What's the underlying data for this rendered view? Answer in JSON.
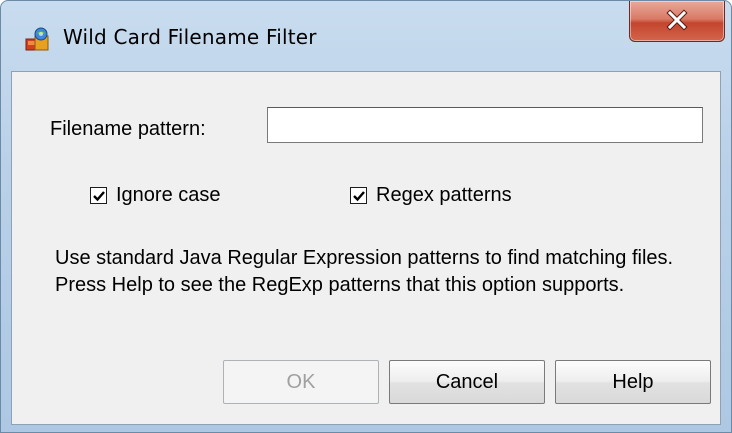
{
  "window": {
    "title": "Wild Card Filename Filter",
    "icon": "app-icon",
    "close_icon": "close-icon"
  },
  "form": {
    "pattern_label": "Filename pattern:",
    "pattern_value": "",
    "pattern_placeholder": ""
  },
  "options": {
    "ignore_case": {
      "label": "Ignore case",
      "checked": true
    },
    "regex_patterns": {
      "label": "Regex patterns",
      "checked": true
    }
  },
  "help_text": "Use standard Java Regular Expression patterns to find matching files. Press Help to see the RegExp patterns that this option supports.",
  "buttons": {
    "ok": {
      "label": "OK",
      "enabled": false
    },
    "cancel": {
      "label": "Cancel",
      "enabled": true
    },
    "help": {
      "label": "Help",
      "enabled": true
    }
  },
  "colors": {
    "frame": "#b9d0e8",
    "client_bg": "#f0f0f0",
    "close_red": "#c4452e",
    "disabled_text": "#a0a0a0"
  }
}
